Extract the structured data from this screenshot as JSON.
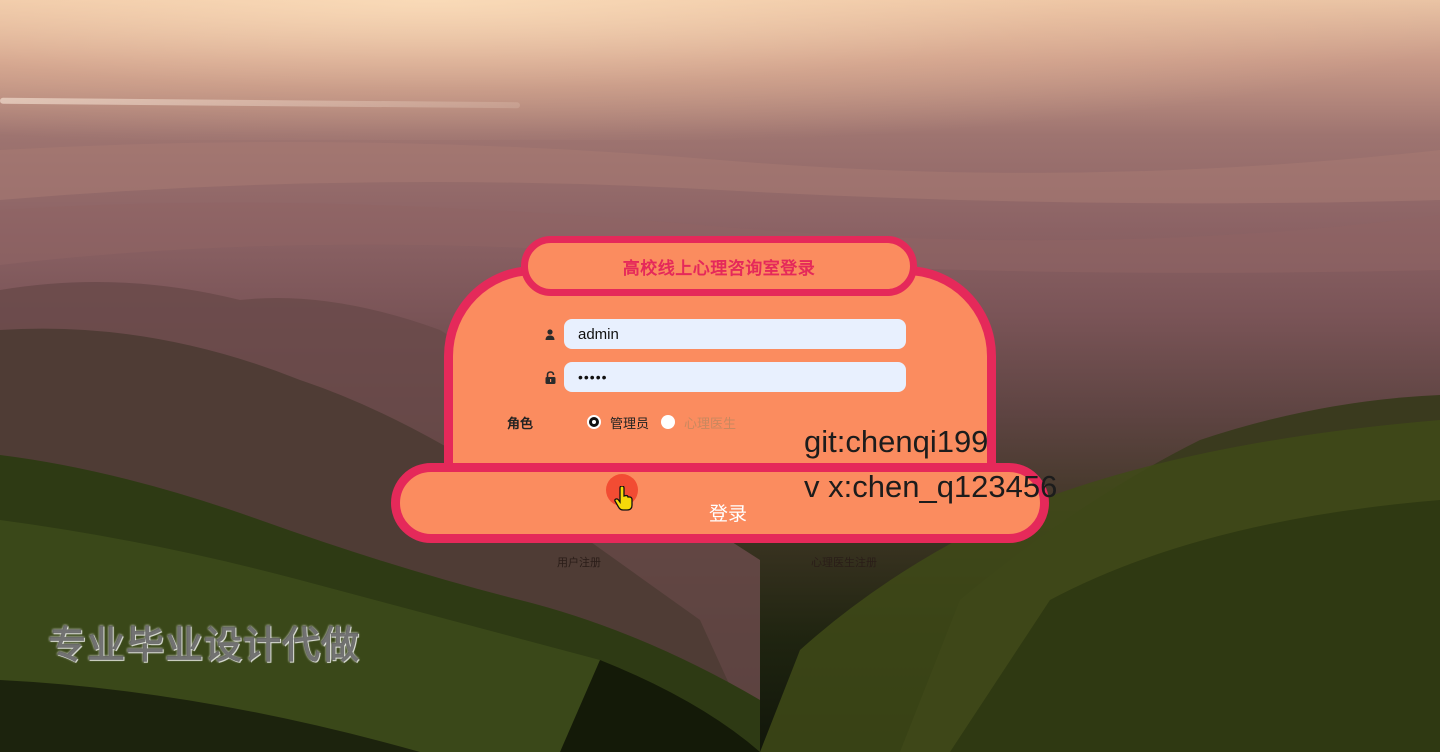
{
  "login": {
    "title": "高校线上心理咨询室登录",
    "username_value": "admin",
    "password_value": "•••••",
    "username_icon": "user-icon",
    "password_icon": "lock-icon",
    "role_label": "角色",
    "roles": [
      {
        "label": "管理员",
        "checked": true
      },
      {
        "label": "心理医生",
        "checked": false
      }
    ],
    "submit_label": "登录",
    "links": [
      "用户注册",
      "心理医生注册"
    ]
  },
  "overlay": {
    "git": "git:chenqi199",
    "contact": "v x:chen_q123456",
    "watermark": "专业毕业设计代做"
  },
  "colors": {
    "accent": "#e5295a",
    "panel": "#fb8c5f",
    "input_bg": "#e8f0fe"
  }
}
